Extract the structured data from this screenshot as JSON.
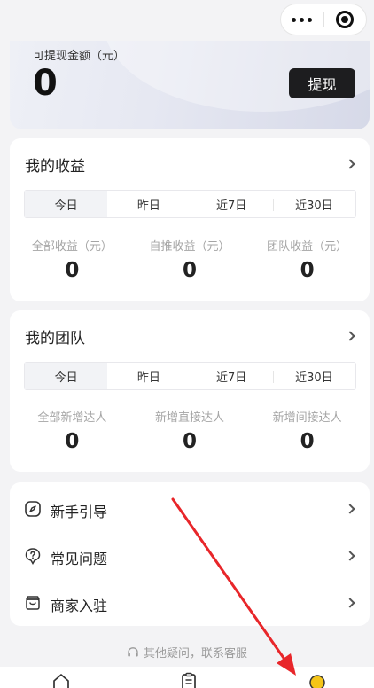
{
  "balance": {
    "label": "可提现金额（元）",
    "amount": "0",
    "withdraw_label": "提现"
  },
  "earnings": {
    "title": "我的收益",
    "tabs": [
      "今日",
      "昨日",
      "近7日",
      "近30日"
    ],
    "stats": [
      {
        "label": "全部收益（元）",
        "value": "0"
      },
      {
        "label": "自推收益（元）",
        "value": "0"
      },
      {
        "label": "团队收益（元）",
        "value": "0"
      }
    ]
  },
  "team": {
    "title": "我的团队",
    "tabs": [
      "今日",
      "昨日",
      "近7日",
      "近30日"
    ],
    "stats": [
      {
        "label": "全部新增达人",
        "value": "0"
      },
      {
        "label": "新增直接达人",
        "value": "0"
      },
      {
        "label": "新增间接达人",
        "value": "0"
      }
    ]
  },
  "menu": [
    {
      "label": "新手引导",
      "icon": "compass-icon"
    },
    {
      "label": "常见问题",
      "icon": "question-bubble-icon"
    },
    {
      "label": "商家入驻",
      "icon": "merchant-icon"
    }
  ],
  "support_text": "其他疑问，联系客服",
  "colors": {
    "accent_dark": "#1d1d1f",
    "annotation_arrow": "#e8262a",
    "active_dot": "#f5c518"
  }
}
